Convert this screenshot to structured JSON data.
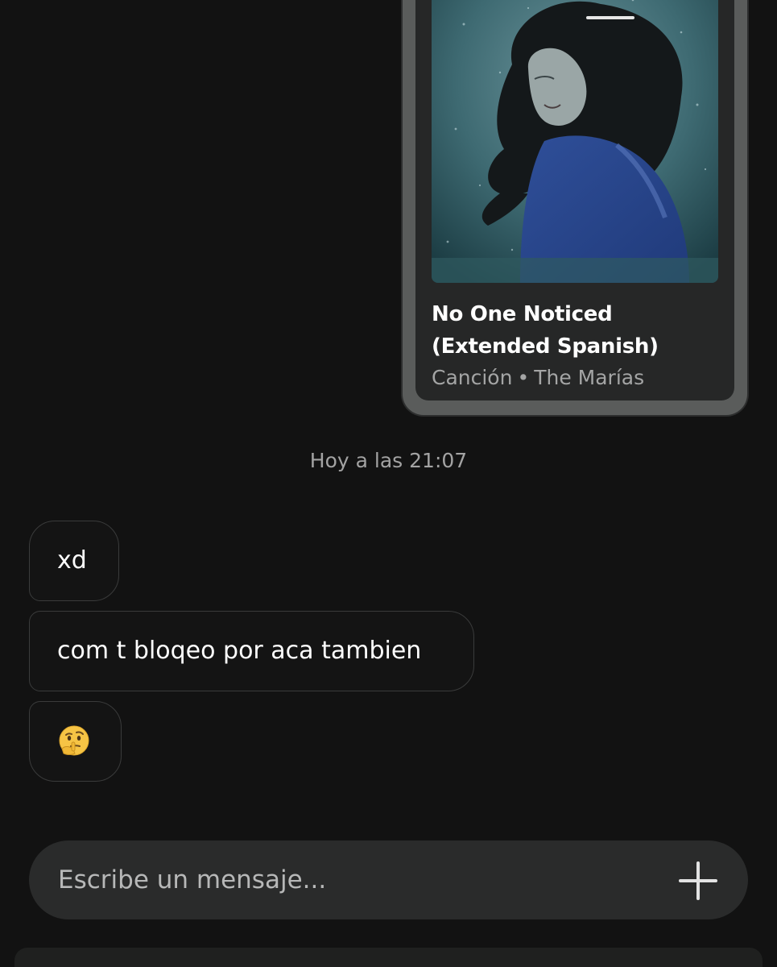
{
  "shared_song": {
    "title": "No One Noticed (Extended Spanish)",
    "type_label": "Canción",
    "separator": "•",
    "artist": "The Marías",
    "artwork_icon": "album-cover-underwater-woman"
  },
  "conversation": {
    "timestamp": "Hoy a las 21:07",
    "messages": [
      {
        "text": "xd"
      },
      {
        "text": "com t bloqeo por aca tambien"
      },
      {
        "emoji": "thinking-face"
      }
    ]
  },
  "composer": {
    "placeholder": "Escribe un mensaje...",
    "value": "",
    "add_icon": "plus-icon"
  },
  "colors": {
    "background": "#121212",
    "card_frame": "#5a5c5b",
    "card_inner": "#262727",
    "bubble_border": "#3a3b3b",
    "composer_bg": "#2a2b2b",
    "muted_text": "#a3a3a3"
  }
}
